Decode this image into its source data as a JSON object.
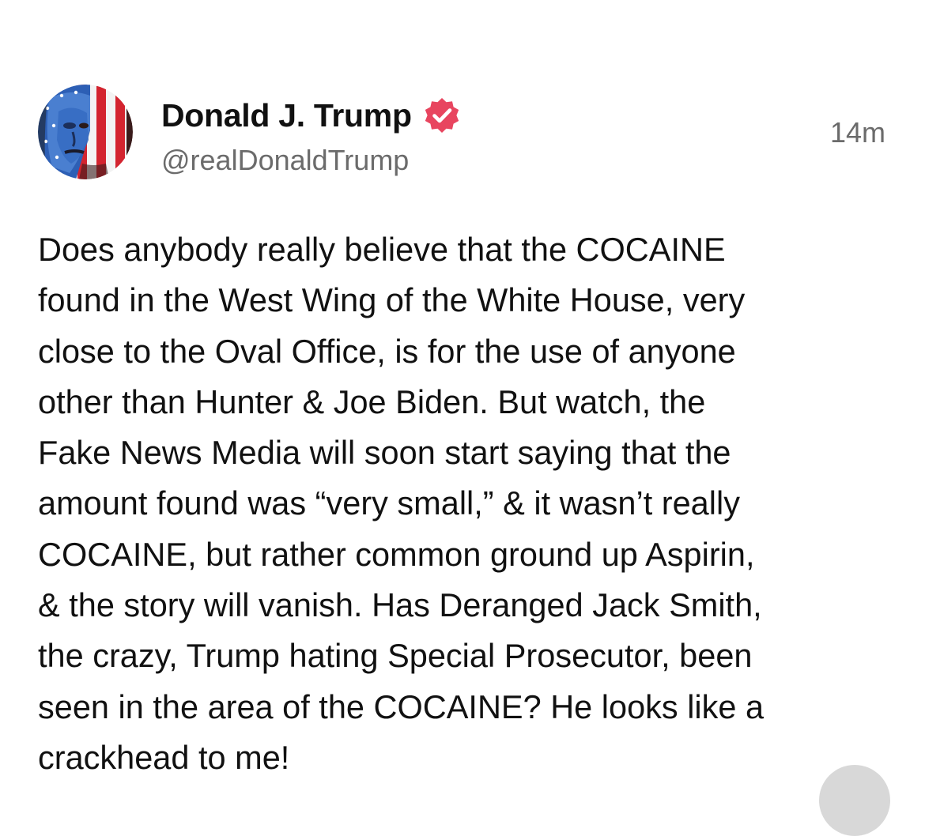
{
  "post": {
    "author": {
      "display_name": "Donald J. Trump",
      "handle": "@realDonaldTrump",
      "verified_badge_icon": "verified-badge-icon",
      "verified_color": "#e8455f"
    },
    "timestamp": "14m",
    "text": "Does anybody really believe that the COCAINE\nfound in the West Wing of the White House, very\nclose to the Oval Office, is for the use of anyone\nother than Hunter & Joe Biden. But watch, the\nFake News Media will soon start saying that the\namount found was “very small,” & it wasn’t really\nCOCAINE, but rather common ground up Aspirin,\n& the story will vanish. Has Deranged Jack Smith,\nthe crazy, Trump hating Special Prosecutor, been\nseen in the area of the COCAINE? He looks like a\ncrackhead to me!"
  }
}
